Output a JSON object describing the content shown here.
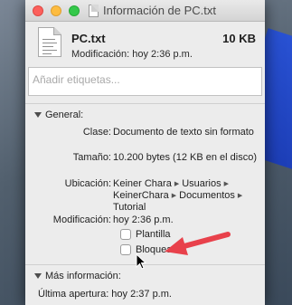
{
  "window": {
    "title": "Información de PC.txt"
  },
  "file": {
    "name": "PC.txt",
    "size": "10 KB",
    "modified": "Modificación: hoy 2:36 p.m."
  },
  "tags": {
    "placeholder": "Añadir etiquetas..."
  },
  "general": {
    "header": "General:",
    "clase_label": "Clase:",
    "clase_value": "Documento de texto sin formato",
    "tamano_label": "Tamaño:",
    "tamano_value": "10.200 bytes (12 KB en el disco)",
    "ubicacion_label": "Ubicación:",
    "ubicacion_path": [
      "Keiner Chara",
      "Usuarios",
      "KeinerChara",
      "Documentos",
      "Tutorial"
    ],
    "modificacion_label": "Modificación:",
    "modificacion_value": "hoy 2:36 p.m.",
    "plantilla_label": "Plantilla",
    "bloqueado_label": "Bloqueado"
  },
  "more_info": {
    "header": "Más información:",
    "last_opened": "Última apertura: hoy 2:37 p.m."
  },
  "colors": {
    "annotation_arrow": "#e8414b"
  }
}
